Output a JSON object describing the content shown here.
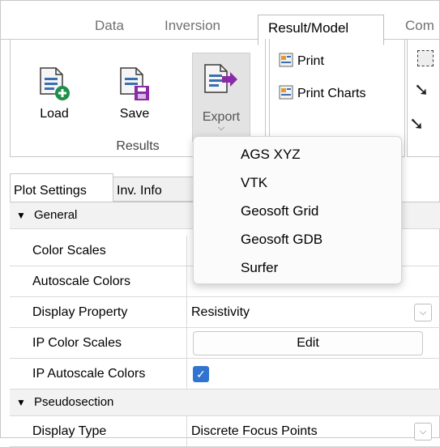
{
  "tabs": [
    {
      "label": "Data"
    },
    {
      "label": "Inversion"
    },
    {
      "label": "Result/Model"
    },
    {
      "label": "Com"
    }
  ],
  "ribbon": {
    "results_group": {
      "label": "Results",
      "load_label": "Load",
      "save_label": "Save",
      "export_label": "Export"
    },
    "print_group": {
      "print_label": "Print",
      "print_charts_label": "Print Charts"
    }
  },
  "export_menu": {
    "items": [
      "AGS XYZ",
      "VTK",
      "Geosoft Grid",
      "Geosoft GDB",
      "Surfer"
    ]
  },
  "panel_tabs": {
    "plot_settings": "Plot Settings",
    "inv_info": "Inv. Info"
  },
  "property_grid": {
    "general": {
      "label": "General",
      "color_scales": "Color Scales",
      "autoscale_colors": "Autoscale Colors",
      "display_property": "Display Property",
      "display_property_value": "Resistivity",
      "ip_color_scales": "IP Color Scales",
      "ip_color_scales_button": "Edit",
      "ip_autoscale_colors": "IP Autoscale Colors"
    },
    "pseudosection": {
      "label": "Pseudosection",
      "display_type": "Display Type",
      "display_type_value": "Discrete Focus Points"
    }
  },
  "colors": {
    "accent_blue": "#2f74d0",
    "export_arrow": "#8a2aa8",
    "load_plus": "#1f8f4a",
    "save_disk": "#8a2aa8"
  },
  "icons": {
    "check": "✓",
    "chevron_down": "⌵",
    "triangle_down": "▼"
  }
}
